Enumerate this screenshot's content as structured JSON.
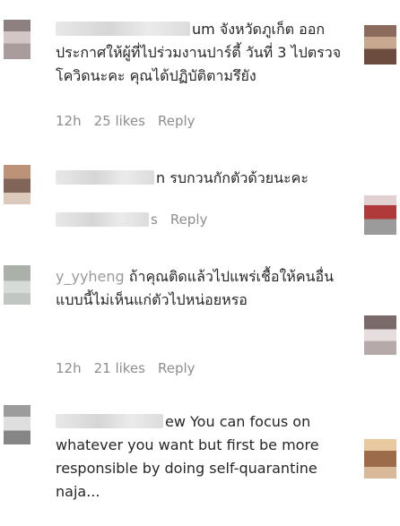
{
  "comments": [
    {
      "username_visible": "um",
      "text": "จังหวัดภูเก็ต ออกประกาศให้ผู้ที่ไปร่วมงานปาร์ตี้ วันที่ 3 ไปตรวจโควิดนะคะ คุณได้ปฏิบัติตามรึยัง",
      "time": "12h",
      "likes": "25 likes",
      "reply": "Reply"
    },
    {
      "username_visible": "n",
      "text": "รบกวนกักตัวด้วยนะคะ",
      "time": "",
      "likes": "s",
      "reply": "Reply"
    },
    {
      "username_visible": "y_yyheng",
      "text": "ถ้าคุณติดแล้วไปแพร่เชื้อให้คนอื่น แบบนี้ไม่เห็นแก่ตัวไปหน่อยหรอ",
      "time": "12h",
      "likes": "21 likes",
      "reply": "Reply"
    },
    {
      "username_visible": "ew",
      "text": "You can focus on whatever you want but first be more responsible by doing self-quarantine naja...",
      "time": "",
      "likes": "",
      "reply": ""
    }
  ]
}
